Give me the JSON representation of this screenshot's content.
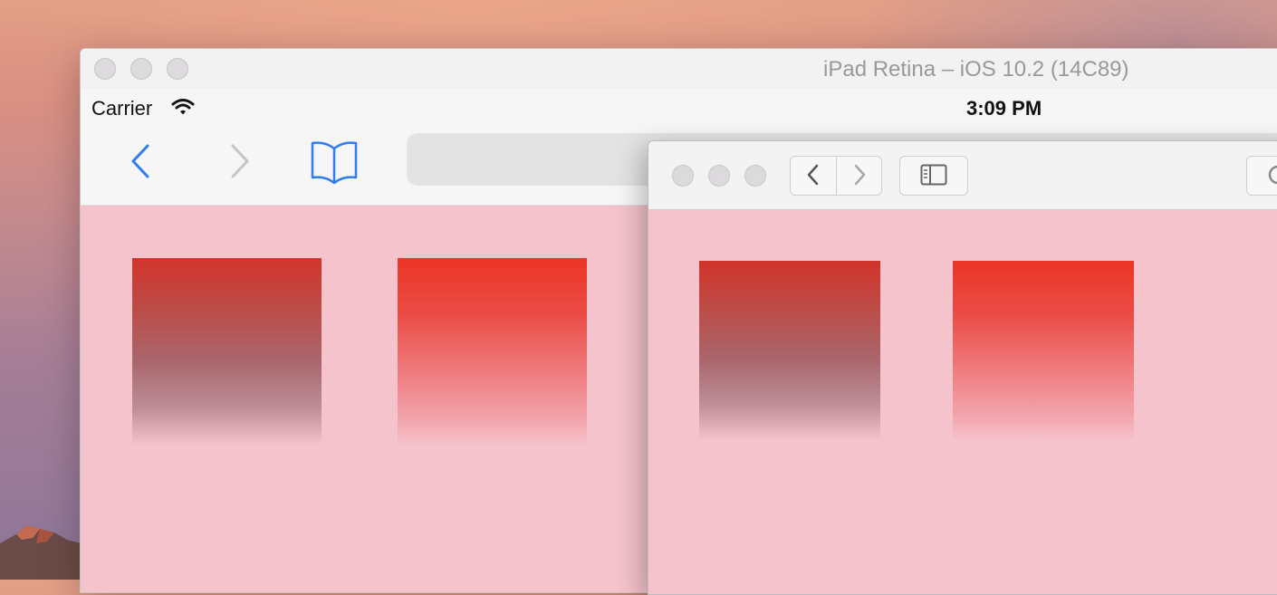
{
  "desktop": {
    "wallpaper": "macOS Sierra mountain wallpaper"
  },
  "simulator": {
    "window_title": "iPad Retina – iOS 10.2 (14C89)",
    "status_bar": {
      "carrier": "Carrier",
      "time": "3:09 PM"
    },
    "toolbar": {
      "back_icon": "chevron-left-icon",
      "forward_icon": "chevron-right-icon",
      "bookmarks_icon": "book-icon",
      "accent_color": "#2f7cf6"
    },
    "content": {
      "background": "#f5c3cb",
      "boxes": [
        {
          "name": "dark-gradient-box",
          "top_color": "#d1342b",
          "bottom_color": "#f5c3cb"
        },
        {
          "name": "bright-gradient-box",
          "top_color": "#ec3527",
          "bottom_color": "#f5c3cb"
        }
      ]
    }
  },
  "safari": {
    "toolbar": {
      "back_icon": "chevron-left-icon",
      "forward_icon": "chevron-right-icon",
      "sidebar_icon": "sidebar-icon",
      "reload_icon": "reload-icon"
    },
    "content": {
      "background": "#f5c3cb",
      "boxes": [
        {
          "name": "dark-gradient-box"
        },
        {
          "name": "bright-gradient-box"
        }
      ]
    }
  }
}
